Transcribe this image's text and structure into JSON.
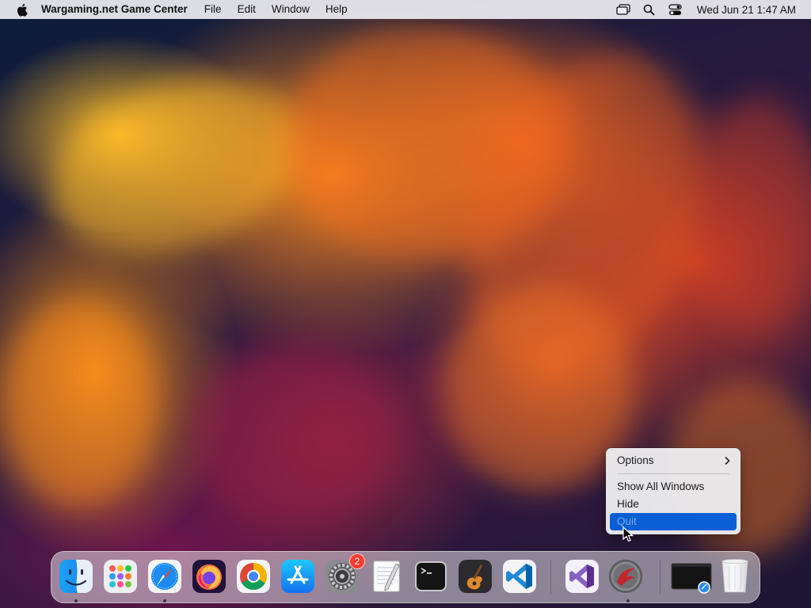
{
  "menubar": {
    "app_name": "Wargaming.net Game Center",
    "menus": [
      "File",
      "Edit",
      "Window",
      "Help"
    ],
    "status_icons": [
      "screen-mirroring-icon",
      "search-icon",
      "control-center-icon"
    ],
    "clock": "Wed Jun 21  1:47 AM"
  },
  "dock": {
    "apps": [
      {
        "name": "Finder",
        "icon": "finder-icon",
        "running": true
      },
      {
        "name": "Launchpad",
        "icon": "launchpad-icon",
        "running": false
      },
      {
        "name": "Safari",
        "icon": "safari-icon",
        "running": true
      },
      {
        "name": "Firefox",
        "icon": "firefox-icon",
        "running": false
      },
      {
        "name": "Google Chrome",
        "icon": "chrome-icon",
        "running": false
      },
      {
        "name": "App Store",
        "icon": "app-store-icon",
        "running": false
      },
      {
        "name": "System Preferences",
        "icon": "system-preferences-icon",
        "running": false,
        "badge": "2"
      },
      {
        "name": "TextEdit",
        "icon": "textedit-icon",
        "running": false
      },
      {
        "name": "Terminal",
        "icon": "terminal-icon",
        "running": false
      },
      {
        "name": "GarageBand",
        "icon": "garageband-icon",
        "running": false
      },
      {
        "name": "Visual Studio Code",
        "icon": "vscode-icon",
        "running": false
      },
      {
        "name": "Visual Studio",
        "icon": "visual-studio-icon",
        "running": false
      },
      {
        "name": "Wargaming.net Game Center",
        "icon": "wargaming-icon",
        "running": true
      }
    ],
    "others": [
      {
        "name": "Screenshot",
        "icon": "screenshot-thumbnail-icon"
      },
      {
        "name": "Trash",
        "icon": "trash-icon"
      }
    ]
  },
  "context_menu": {
    "options_label": "Options",
    "show_all_windows_label": "Show All Windows",
    "hide_label": "Hide",
    "quit_label": "Quit",
    "highlight_color": "#0a5fd6"
  }
}
